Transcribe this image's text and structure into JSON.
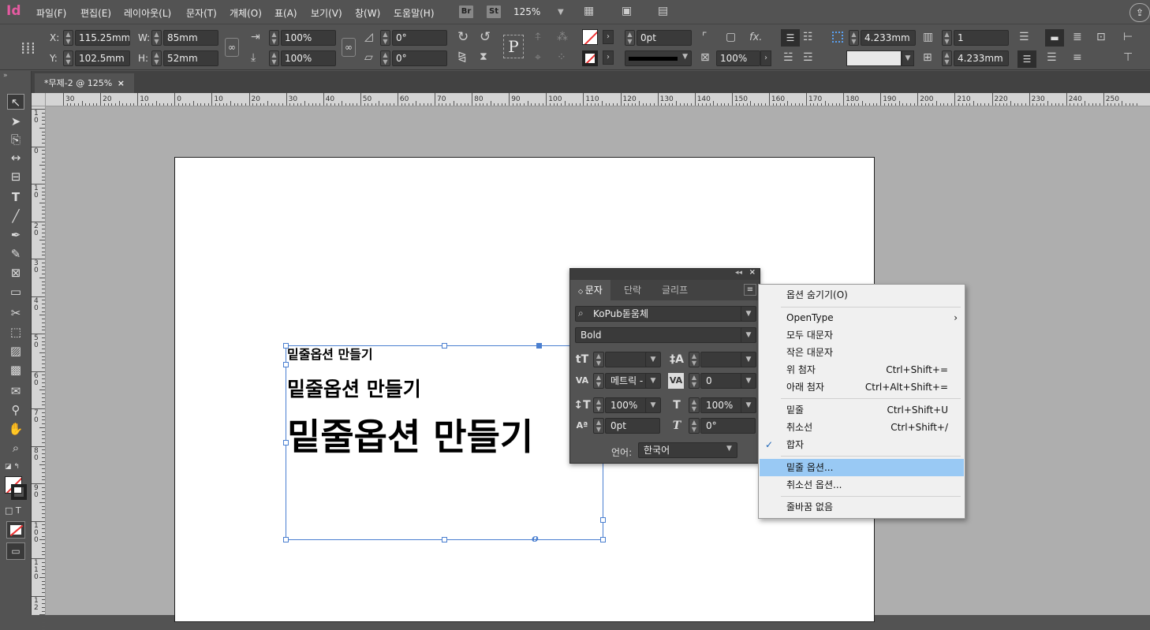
{
  "app": {
    "logo": "Id"
  },
  "menu": [
    "파일(F)",
    "편집(E)",
    "레이아웃(L)",
    "문자(T)",
    "개체(O)",
    "표(A)",
    "보기(V)",
    "창(W)",
    "도움말(H)"
  ],
  "bridge": {
    "br": "Br",
    "st": "St"
  },
  "zoom": "125%",
  "control": {
    "x_label": "X:",
    "x_value": "115.25mm",
    "y_label": "Y:",
    "y_value": "102.5mm",
    "w_label": "W:",
    "w_value": "85mm",
    "h_label": "H:",
    "h_value": "52mm",
    "scale_x": "100%",
    "scale_y": "100%",
    "rotate": "0°",
    "shear": "0°",
    "stroke_weight": "0pt",
    "opacity": "100%",
    "fx": "fx.",
    "gap_value": "4.233mm",
    "columns": "1",
    "gutter": "4.233mm"
  },
  "doc_tab": {
    "title": "*무제-2 @ 125%",
    "close": "×"
  },
  "ruler_top": [
    "30",
    "20",
    "10",
    "0",
    "10",
    "20",
    "30",
    "40",
    "50",
    "60",
    "70",
    "80",
    "90",
    "100",
    "110",
    "120",
    "130",
    "140",
    "150",
    "160",
    "170",
    "180",
    "190",
    "200",
    "210",
    "220",
    "230",
    "240",
    "250"
  ],
  "ruler_left": [
    "1\n0",
    "0",
    "1\n0",
    "2\n0",
    "3\n0",
    "4\n0",
    "5\n0",
    "6\n0",
    "7\n0",
    "8\n0",
    "9\n0",
    "1\n0\n0",
    "1\n1\n0",
    "1\n2"
  ],
  "canvas": {
    "line1": "밑줄옵션 만들기",
    "line2": "밑줄옵션 만들기",
    "line3": "밑줄옵션 만들기"
  },
  "char_panel": {
    "tabs": [
      "문자",
      "단락",
      "글리프"
    ],
    "font_family": "KoPub돋움체",
    "font_style": "Bold",
    "size": "",
    "leading": "",
    "kerning": "메트릭 -",
    "tracking": "0",
    "vscale": "100%",
    "hscale": "100%",
    "baseline": "0pt",
    "skew": "0°",
    "language_label": "언어:",
    "language": "한국어"
  },
  "flyout": [
    {
      "label": "옵션 숨기기(O)",
      "shortcut": ""
    },
    {
      "label": "OpenType",
      "shortcut": "›"
    },
    {
      "label": "모두 대문자",
      "shortcut": ""
    },
    {
      "label": "작은 대문자",
      "shortcut": ""
    },
    {
      "label": "위 첨자",
      "shortcut": "Ctrl+Shift+="
    },
    {
      "label": "아래 첨자",
      "shortcut": "Ctrl+Alt+Shift+="
    },
    {
      "label": "밑줄",
      "shortcut": "Ctrl+Shift+U"
    },
    {
      "label": "취소선",
      "shortcut": "Ctrl+Shift+/"
    },
    {
      "label": "합자",
      "shortcut": ""
    },
    {
      "label": "밑줄 옵션...",
      "shortcut": ""
    },
    {
      "label": "취소선 옵션...",
      "shortcut": ""
    },
    {
      "label": "줄바꿈 없음",
      "shortcut": ""
    }
  ],
  "flyout_state": {
    "checked_item": "합자",
    "highlighted_item": "밑줄 옵션..."
  },
  "colors": {
    "accent": "#4a7fd0",
    "highlight": "#99c9f4",
    "logo": "#e45aa0"
  }
}
